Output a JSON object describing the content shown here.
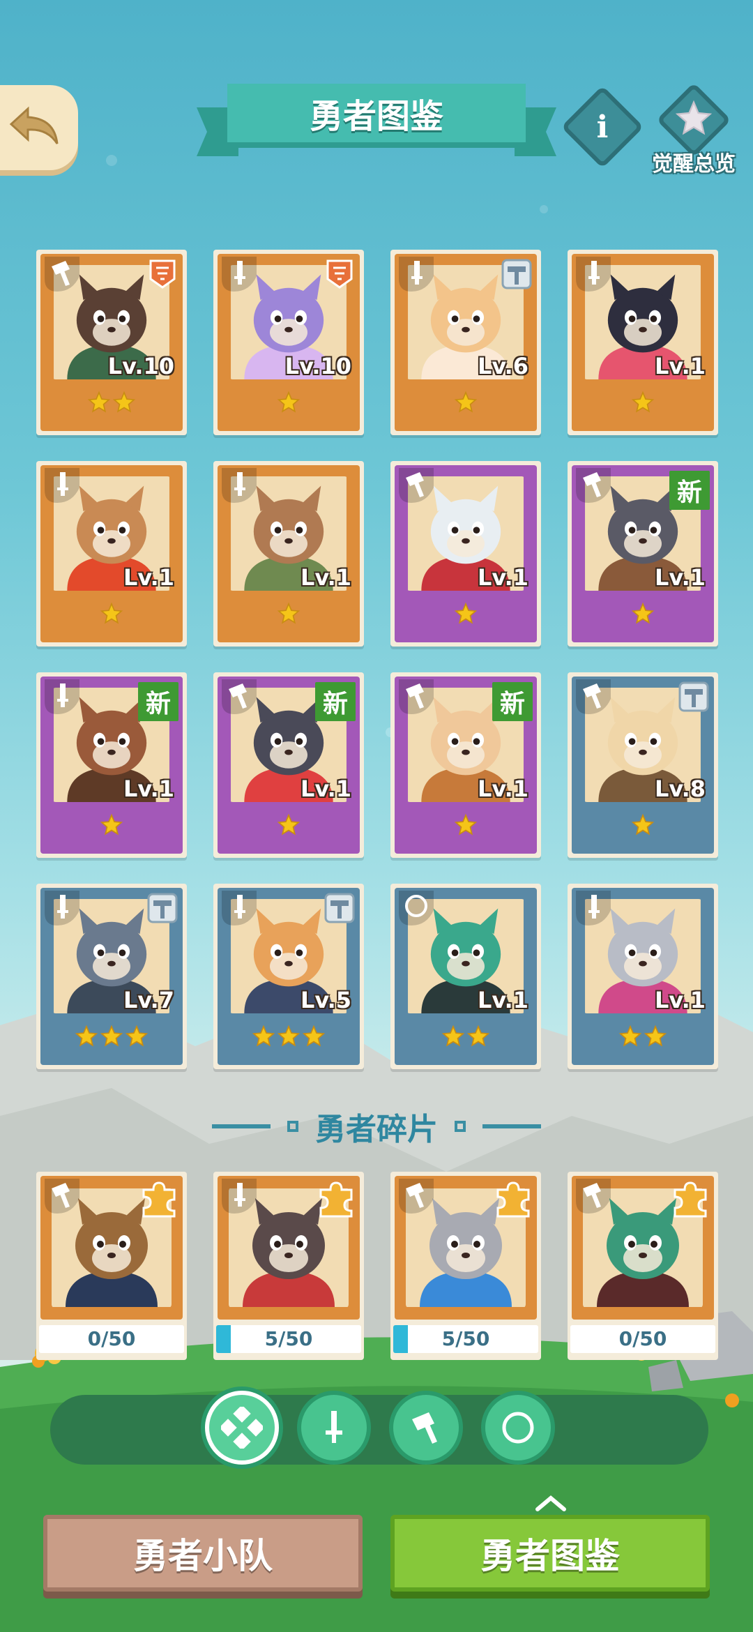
{
  "header": {
    "title": "勇者图鉴",
    "info_icon": "i",
    "awaken_label": "觉醒总览"
  },
  "heroes": [
    {
      "rarity": "orange",
      "class": "hammer",
      "corner": "rank-icon",
      "level": "Lv.10",
      "stars": 2,
      "fur": "#5a4034",
      "accent": "#3c6b4a"
    },
    {
      "rarity": "orange",
      "class": "sword",
      "corner": "rank-icon",
      "level": "Lv.10",
      "stars": 1,
      "fur": "#9d86d8",
      "accent": "#d8b6f0"
    },
    {
      "rarity": "orange",
      "class": "sword",
      "corner": "hammer-badge",
      "level": "Lv.6",
      "stars": 1,
      "fur": "#f3c48a",
      "accent": "#fbe9d6"
    },
    {
      "rarity": "orange",
      "class": "sword",
      "corner": "",
      "level": "Lv.1",
      "stars": 1,
      "fur": "#2e2e3e",
      "accent": "#e6556e"
    },
    {
      "rarity": "orange",
      "class": "sword",
      "corner": "",
      "level": "Lv.1",
      "stars": 1,
      "fur": "#c98a54",
      "accent": "#e34a2b"
    },
    {
      "rarity": "orange",
      "class": "sword",
      "corner": "",
      "level": "Lv.1",
      "stars": 1,
      "fur": "#b07a52",
      "accent": "#6f8a50"
    },
    {
      "rarity": "purple",
      "class": "hammer",
      "corner": "",
      "level": "Lv.1",
      "stars": 1,
      "fur": "#e8eef2",
      "accent": "#c8343c"
    },
    {
      "rarity": "purple",
      "class": "hammer",
      "corner": "new",
      "level": "Lv.1",
      "stars": 1,
      "fur": "#5a5a66",
      "accent": "#8a5a3a"
    },
    {
      "rarity": "purple",
      "class": "sword",
      "corner": "new",
      "level": "Lv.1",
      "stars": 1,
      "fur": "#9a5a3a",
      "accent": "#5e3a26"
    },
    {
      "rarity": "purple",
      "class": "hammer",
      "corner": "new",
      "level": "Lv.1",
      "stars": 1,
      "fur": "#4a4a58",
      "accent": "#e04040"
    },
    {
      "rarity": "purple",
      "class": "hammer",
      "corner": "new",
      "level": "Lv.1",
      "stars": 1,
      "fur": "#f0c89a",
      "accent": "#c77a3a"
    },
    {
      "rarity": "blue",
      "class": "hammer",
      "corner": "hammer-badge",
      "level": "Lv.8",
      "stars": 1,
      "fur": "#f0d6a8",
      "accent": "#7a5a3a"
    },
    {
      "rarity": "blue",
      "class": "sword",
      "corner": "hammer-badge",
      "level": "Lv.7",
      "stars": 3,
      "fur": "#6a7a8e",
      "accent": "#3c4a5a"
    },
    {
      "rarity": "blue",
      "class": "sword",
      "corner": "hammer-badge",
      "level": "Lv.5",
      "stars": 3,
      "fur": "#e8a25a",
      "accent": "#3c4a6a"
    },
    {
      "rarity": "blue",
      "class": "compass",
      "corner": "",
      "level": "Lv.1",
      "stars": 2,
      "fur": "#3aa88c",
      "accent": "#2a3a3a"
    },
    {
      "rarity": "blue",
      "class": "sword",
      "corner": "",
      "level": "Lv.1",
      "stars": 2,
      "fur": "#b8bcc6",
      "accent": "#d04a8a"
    }
  ],
  "new_badge_label": "新",
  "fragments_title": "勇者碎片",
  "fragments": [
    {
      "class": "hammer",
      "progress": "0/50",
      "fill": 0,
      "fur": "#9a6a3a",
      "accent": "#2a3a5a"
    },
    {
      "class": "sword",
      "progress": "5/50",
      "fill": 0.1,
      "fur": "#5a4a4a",
      "accent": "#c83a3a"
    },
    {
      "class": "hammer",
      "progress": "5/50",
      "fill": 0.1,
      "fur": "#a8aab2",
      "accent": "#3a8ad8"
    },
    {
      "class": "hammer",
      "progress": "0/50",
      "fill": 0,
      "fur": "#3a9a7a",
      "accent": "#5a2a2a"
    }
  ],
  "filters": [
    {
      "name": "all",
      "icon": "four-diamond-icon",
      "active": true
    },
    {
      "name": "sword",
      "icon": "sword-icon",
      "active": false
    },
    {
      "name": "hammer",
      "icon": "hammer-icon",
      "active": false
    },
    {
      "name": "compass",
      "icon": "compass-icon",
      "active": false
    }
  ],
  "bottom": {
    "team_label": "勇者小队",
    "catalog_label": "勇者图鉴"
  },
  "colors": {
    "orange": "#dd8d3b",
    "purple": "#a358b8",
    "blue": "#5a89a6",
    "star": "#f5c518"
  }
}
